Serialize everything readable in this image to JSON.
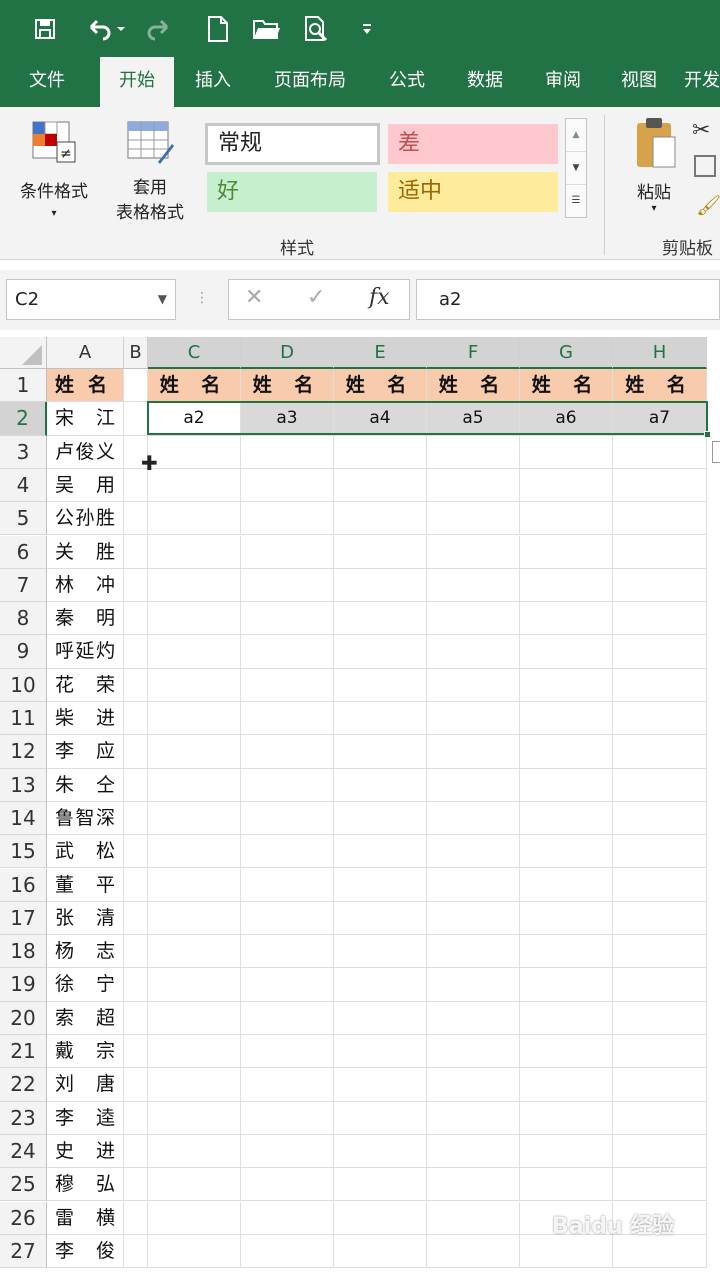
{
  "qat": {
    "icons": [
      "save-icon",
      "undo-icon",
      "redo-icon",
      "new-file-icon",
      "open-folder-icon",
      "print-preview-icon",
      "customize-qat-icon"
    ]
  },
  "tabs": [
    "文件",
    "开始",
    "插入",
    "页面布局",
    "公式",
    "数据",
    "审阅",
    "视图",
    "开发"
  ],
  "active_tab": "开始",
  "ribbon": {
    "cond_format": "条件格式",
    "table_format_1": "套用",
    "table_format_2": "表格格式",
    "styles": {
      "normal": "常规",
      "bad": "差",
      "good": "好",
      "neutral": "适中"
    },
    "styles_group": "样式",
    "paste": "粘贴",
    "clipboard_group": "剪贴板"
  },
  "formula_bar": {
    "name_box": "C2",
    "cancel": "✕",
    "enter": "✓",
    "fx": "fx",
    "value": "a2"
  },
  "columns": [
    "A",
    "B",
    "C",
    "D",
    "E",
    "F",
    "G",
    "H"
  ],
  "header_row": [
    "姓 名",
    "姓 名",
    "姓 名",
    "姓 名",
    "姓 名",
    "姓 名"
  ],
  "data_row": [
    "a2",
    "a3",
    "a4",
    "a5",
    "a6",
    "a7"
  ],
  "names": [
    "姓名",
    "宋江",
    "卢俊义",
    "吴用",
    "公孙胜",
    "关胜",
    "林冲",
    "秦明",
    "呼延灼",
    "花荣",
    "柴进",
    "李应",
    "朱仝",
    "鲁智深",
    "武松",
    "董平",
    "张清",
    "杨志",
    "徐宁",
    "索超",
    "戴宗",
    "刘唐",
    "李逵",
    "史进",
    "穆弘",
    "雷横",
    "李俊"
  ],
  "rows": [
    "1",
    "2",
    "3",
    "4",
    "5",
    "6",
    "7",
    "8",
    "9",
    "10",
    "11",
    "12",
    "13",
    "14",
    "15",
    "16",
    "17",
    "18",
    "19",
    "20",
    "21",
    "22",
    "23",
    "24",
    "25",
    "26",
    "27"
  ],
  "watermark": "Baidu经验 jingyan.baidu.com"
}
